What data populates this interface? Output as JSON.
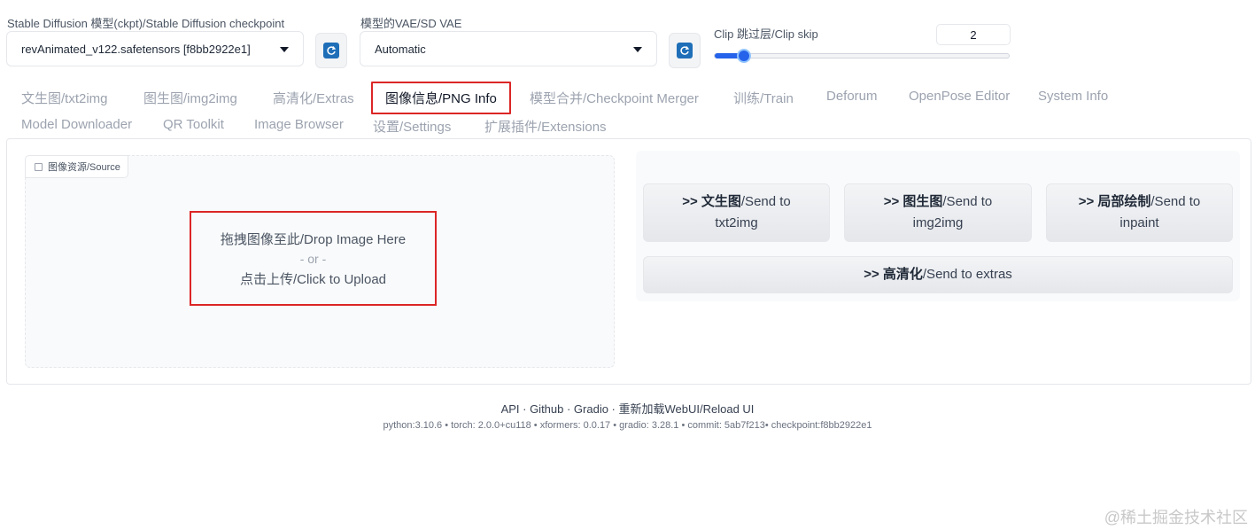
{
  "top": {
    "ckpt_label": "Stable Diffusion 模型(ckpt)/Stable Diffusion checkpoint",
    "ckpt_value": "revAnimated_v122.safetensors [f8bb2922e1]",
    "vae_label": "模型的VAE/SD VAE",
    "vae_value": "Automatic",
    "clip_label": "Clip 跳过层/Clip skip",
    "clip_value": "2",
    "clip_slider_fraction": 0.1
  },
  "tabs": [
    {
      "label": "文生图/txt2img"
    },
    {
      "label": "图生图/img2img"
    },
    {
      "label": "高清化/Extras"
    },
    {
      "label": "图像信息/PNG Info"
    },
    {
      "label": "模型合并/Checkpoint Merger"
    },
    {
      "label": "训练/Train"
    },
    {
      "label": "Deforum"
    },
    {
      "label": "OpenPose Editor"
    },
    {
      "label": "System Info"
    },
    {
      "label": "Model Downloader"
    },
    {
      "label": "QR Toolkit"
    },
    {
      "label": "Image Browser"
    },
    {
      "label": "设置/Settings"
    },
    {
      "label": "扩展插件/Extensions"
    }
  ],
  "source": {
    "tag": "图像资源/Source",
    "drop_text": "拖拽图像至此/Drop Image Here",
    "or_text": "- or -",
    "click_text": "点击上传/Click to Upload"
  },
  "send": {
    "txt2img_bold": ">> 文生图",
    "txt2img_rest1": "/Send to",
    "txt2img_rest2": "txt2img",
    "img2img_bold": ">> 图生图",
    "img2img_rest1": "/Send to",
    "img2img_rest2": "img2img",
    "inpaint_bold": ">> 局部绘制",
    "inpaint_rest1": "/Send to",
    "inpaint_rest2": "inpaint",
    "extras_bold": ">> 高清化",
    "extras_rest": "/Send to extras"
  },
  "footer": {
    "links": "API · Github · Gradio · 重新加载WebUI/Reload UI",
    "versions": "python:3.10.6  •  torch: 2.0.0+cu118  •  xformers: 0.0.17  •  gradio: 3.28.1  •  commit: 5ab7f213•  checkpoint:f8bb2922e1"
  },
  "watermark": "@稀土掘金技术社区",
  "colors": {
    "accent": "#2563eb",
    "highlight": "#dc2626"
  }
}
